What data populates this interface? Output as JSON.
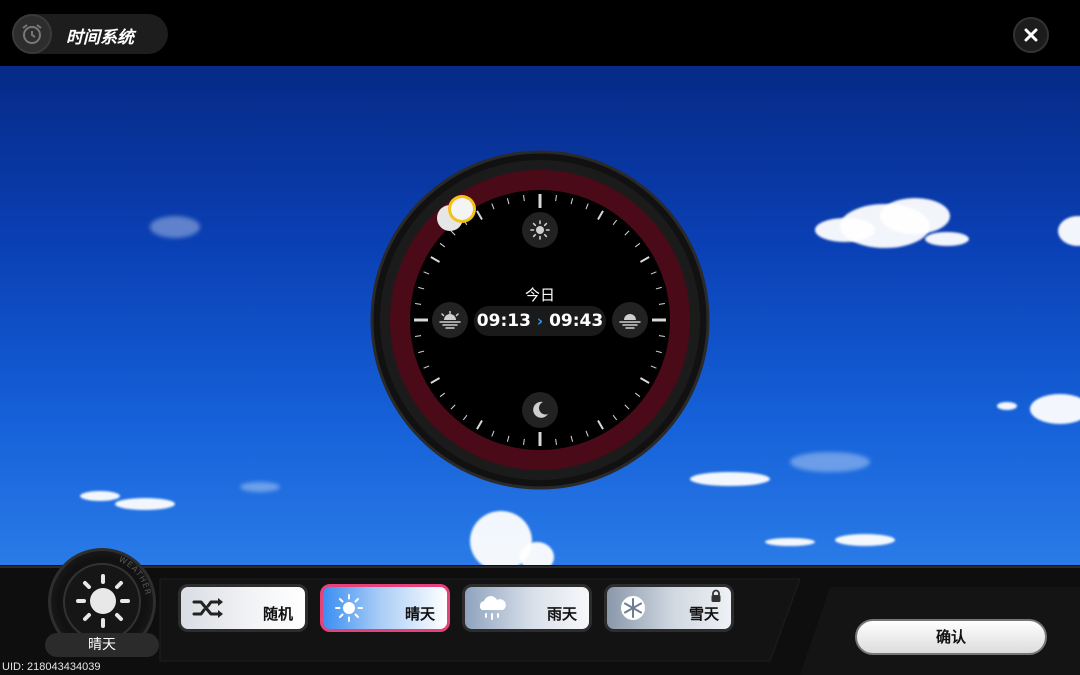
{
  "header": {
    "title": "时间系统",
    "icon": "alarm-clock-icon",
    "close_icon": "close-icon"
  },
  "clock": {
    "day_label": "今日",
    "current_time": "09:13",
    "target_time": "09:43",
    "arrow": "›",
    "icons": {
      "top": "sun-icon",
      "left": "sunrise-icon",
      "right": "sunset-icon",
      "bottom": "moon-icon"
    },
    "ring_color": "#4a0a18"
  },
  "weather": {
    "current_label": "晴天",
    "dial_text": "WEATHER",
    "options": [
      {
        "label": "随机",
        "icon": "shuffle-icon",
        "selected": false,
        "locked": false
      },
      {
        "label": "晴天",
        "icon": "sun-icon",
        "selected": true,
        "locked": false
      },
      {
        "label": "雨天",
        "icon": "rain-cloud-icon",
        "selected": false,
        "locked": false
      },
      {
        "label": "雪天",
        "icon": "snowflake-icon",
        "selected": false,
        "locked": true
      }
    ],
    "selected_border_color": "#e5417a"
  },
  "confirm_label": "确认",
  "uid_text": "UID: 218043434039"
}
